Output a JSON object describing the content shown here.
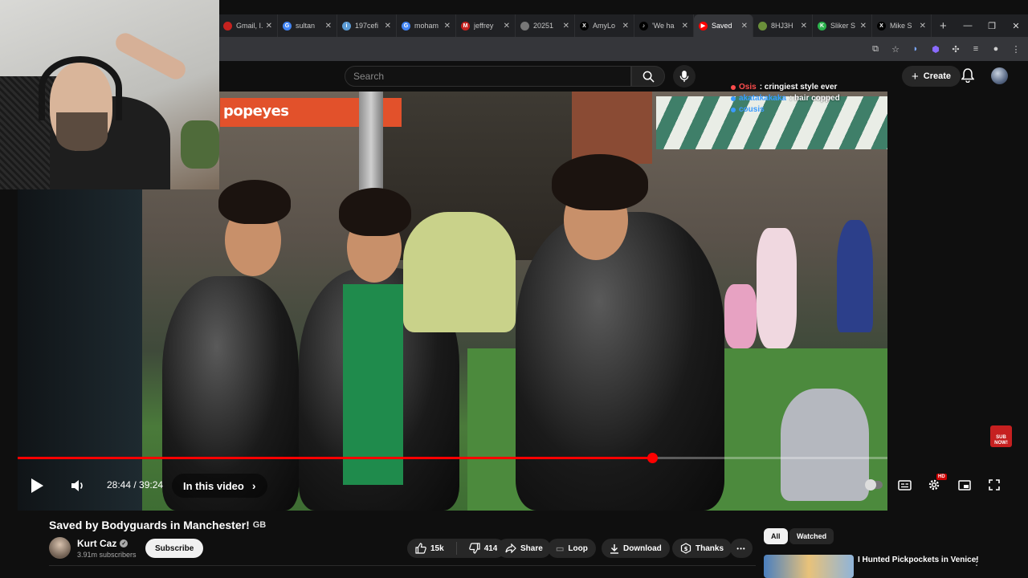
{
  "browser": {
    "tabs": [
      {
        "label": "Gmail, I...",
        "fav_color": "#c5221f",
        "fav_glyph": ""
      },
      {
        "label": "sultan",
        "fav_color": "#4285f4",
        "fav_glyph": "G"
      },
      {
        "label": "197cefi",
        "fav_color": "#5b9bd5",
        "fav_glyph": "i"
      },
      {
        "label": "moham",
        "fav_color": "#4285f4",
        "fav_glyph": "G"
      },
      {
        "label": "jeffrey",
        "fav_color": "#c5221f",
        "fav_glyph": "M"
      },
      {
        "label": "20251",
        "fav_color": "#777777",
        "fav_glyph": ""
      },
      {
        "label": "AmyLo",
        "fav_color": "#000000",
        "fav_glyph": "X"
      },
      {
        "label": "'We ha",
        "fav_color": "#000000",
        "fav_glyph": "♪"
      },
      {
        "label": "Saved",
        "fav_color": "#ff0000",
        "fav_glyph": "▶"
      },
      {
        "label": "8HJ3H",
        "fav_color": "#6a8f3a",
        "fav_glyph": ""
      },
      {
        "label": "Sliker S",
        "fav_color": "#2bb24c",
        "fav_glyph": "K"
      },
      {
        "label": "Mike S",
        "fav_color": "#000000",
        "fav_glyph": "X"
      }
    ],
    "active_tab_index": 8,
    "new_tab": "+"
  },
  "header": {
    "search_placeholder": "Search",
    "create_label": "Create"
  },
  "chat": [
    {
      "user": "Osis",
      "message": ": cringiest style ever",
      "color": "#ff4d4d"
    },
    {
      "user": "akatakakaka",
      "message": ": hair copped",
      "color": "#3a9bff"
    },
    {
      "user": "cousis",
      "message": "",
      "color": "#3a9bff"
    }
  ],
  "player": {
    "current_time": "28:44",
    "separator": " / ",
    "duration": "39:24",
    "progress_fraction": 0.729,
    "chapter_label": "In this video",
    "hd_badge": "HD",
    "sub_now": "SUB NOW!"
  },
  "video": {
    "title": "Saved by Bodyguards in Manchester!",
    "region_badge": "GB",
    "storefront_sign": "popeyes"
  },
  "channel": {
    "name": "Kurt Caz",
    "subscribers": "3.91m subscribers",
    "subscribe_label": "Subscribe"
  },
  "actions": {
    "likes": "15k",
    "dislikes": "414",
    "share": "Share",
    "loop": "Loop",
    "download": "Download",
    "thanks": "Thanks",
    "more": "•••"
  },
  "sidebar": {
    "chips": [
      "All",
      "Watched"
    ],
    "active_chip_index": 0,
    "recommended": [
      {
        "title": "I Hunted Pickpockets in Venice!"
      }
    ]
  },
  "colors": {
    "accent": "#ff0000",
    "background": "#0f0f0f",
    "pill": "#272727"
  }
}
